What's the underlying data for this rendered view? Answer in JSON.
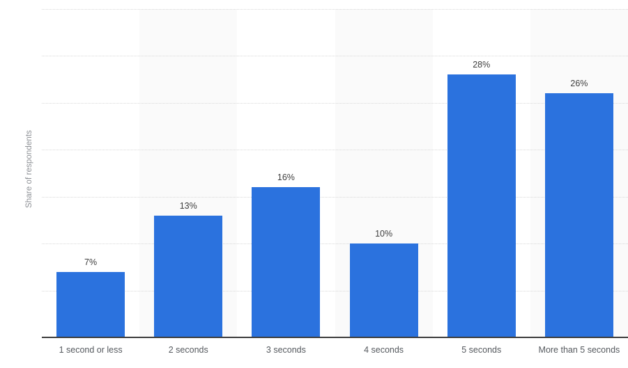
{
  "chart_data": {
    "type": "bar",
    "title": "",
    "subtitle": "",
    "xlabel": "",
    "ylabel": "Share of respondents",
    "categories": [
      "1 second or less",
      "2 seconds",
      "3 seconds",
      "4 seconds",
      "5 seconds",
      "More than 5 seconds"
    ],
    "values": [
      7,
      13,
      16,
      10,
      28,
      26
    ],
    "value_labels": [
      "7%",
      "13%",
      "16%",
      "10%",
      "28%",
      "26%"
    ],
    "ylim": [
      0,
      35
    ],
    "y_ticks": [
      0,
      5,
      10,
      15,
      20,
      25,
      30,
      35
    ],
    "y_tick_labels": [],
    "grid": true,
    "legend": false,
    "legend_position": "none",
    "series": [
      {
        "name": "Share of respondents",
        "values": [
          7,
          13,
          16,
          10,
          28,
          26
        ],
        "color": "#2b72de"
      }
    ],
    "colors": {
      "bar": "#2b72de",
      "gridline": "#d8d8d8",
      "axis": "#3c3c3c",
      "band": "#fafafa",
      "value_label": "#3d3d3d",
      "category_label": "#55595e",
      "axis_title": "#8c8f94",
      "background": "#ffffff"
    }
  },
  "axis": {
    "y_title": "Share of respondents"
  }
}
